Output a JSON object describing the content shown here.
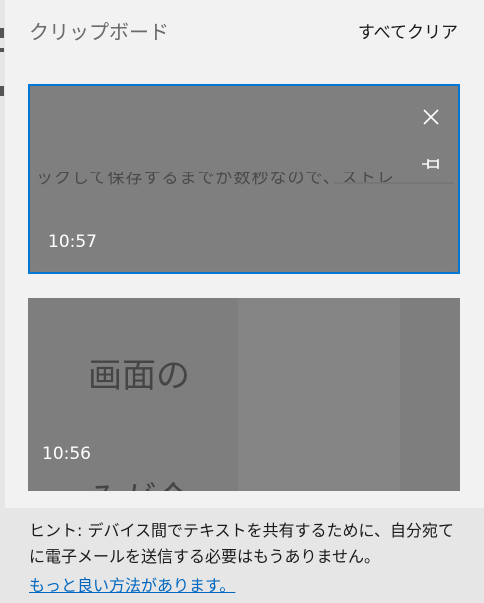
{
  "panel": {
    "title": "クリップボード",
    "clear_all_label": "すべてクリア"
  },
  "clips": [
    {
      "preview_text": "ックして保存するまでが数秒なので、ストレスが上",
      "time": "10:57",
      "selected": true,
      "close_icon": "close-icon",
      "pin_icon": "pin-icon"
    },
    {
      "preview_line1": "画面の",
      "preview_line2": "みが今",
      "time": "10:56",
      "selected": false
    }
  ],
  "hint": {
    "text": "ヒント: デバイス間でテキストを共有するために、自分宛てに電子メールを送信する必要はもうありません。",
    "link": "もっと良い方法があります。"
  },
  "colors": {
    "accent": "#0078d4",
    "link": "#0067c0",
    "background": "#f2f2f2",
    "hint_background": "#e6e6e6",
    "clip_background": "#808080"
  }
}
